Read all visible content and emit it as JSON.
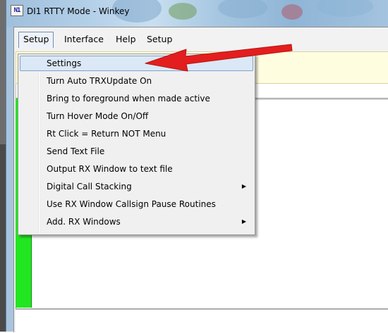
{
  "window": {
    "title": "DI1 RTTY Mode - Winkey",
    "icon_label": "N1"
  },
  "menubar": {
    "items": [
      {
        "label": "Setup",
        "open": true
      },
      {
        "label": "Interface"
      },
      {
        "label": "Help"
      },
      {
        "label": "Setup"
      }
    ]
  },
  "dropdown": {
    "items": [
      {
        "label": "Settings",
        "highlighted": true
      },
      {
        "label": "Turn Auto TRXUpdate On"
      },
      {
        "label": "Bring to foreground when made active"
      },
      {
        "label": "Turn Hover Mode On/Off"
      },
      {
        "label": "Rt Click = Return NOT Menu"
      },
      {
        "label": "Send Text File"
      },
      {
        "label": "Output RX Window to text file"
      },
      {
        "label": "Digital Call Stacking",
        "submenu": true
      },
      {
        "label": "Use RX Window Callsign Pause Routines"
      },
      {
        "label": "Add. RX Windows",
        "submenu": true
      }
    ],
    "submenu_arrow": "▶"
  },
  "colors": {
    "highlight": "#dbe8f5",
    "annotation_arrow": "#e31e1e",
    "rx_indicator": "#22e622",
    "info_band": "#fffde0"
  },
  "icons": [
    "app-logo-icon",
    "submenu-arrow-icon",
    "red-pointer-arrow-icon"
  ]
}
